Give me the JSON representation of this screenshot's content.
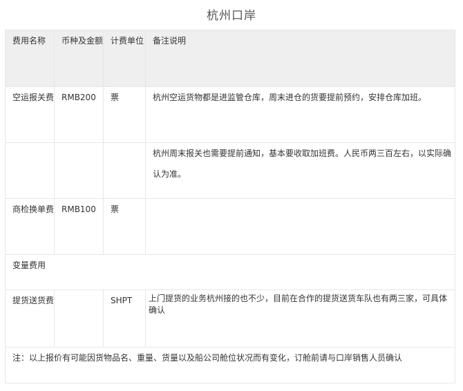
{
  "title": "杭州口岸",
  "table": {
    "headers": [
      "费用名称",
      "币种及金额",
      "计费单位",
      "备注说明"
    ],
    "rows": [
      {
        "name": "空运报关费",
        "amount": "RMB200",
        "unit": "票",
        "note": "杭州空运货物都是进监管仓库，周末进仓的货要提前预约，安排仓库加班。"
      },
      {
        "name": "",
        "amount": "",
        "unit": "",
        "note": "杭州周末报关也需要提前通知，基本要收取加班费。人民币两三百左右，以实际确认为准。"
      },
      {
        "name": "商检换单费",
        "amount": "RMB100",
        "unit": "票",
        "note": ""
      },
      {
        "section": "变量费用"
      },
      {
        "name": "提货送货费",
        "amount": "",
        "unit": "SHPT",
        "note": "上门提货的业务杭州接的也不少，目前在合作的提货送货车队也有两三家，可具体确认"
      }
    ],
    "footnote": "注：以上报价有可能因货物品名、重量、货量以及船公司舱位状况而有变化，订舱前请与口岸销售人员确认"
  }
}
